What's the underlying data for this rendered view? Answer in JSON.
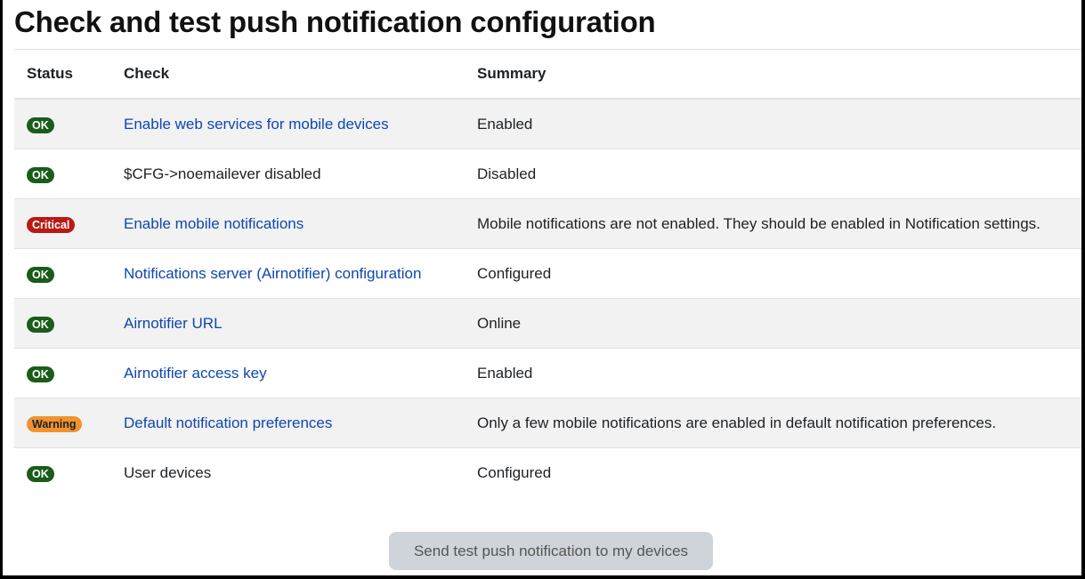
{
  "page": {
    "title": "Check and test push notification configuration"
  },
  "table": {
    "headers": {
      "status": "Status",
      "check": "Check",
      "summary": "Summary"
    },
    "rows": [
      {
        "status": "OK",
        "status_type": "ok",
        "check": "Enable web services for mobile devices",
        "check_is_link": true,
        "summary": "Enabled"
      },
      {
        "status": "OK",
        "status_type": "ok",
        "check": "$CFG->noemailever disabled",
        "check_is_link": false,
        "summary": "Disabled"
      },
      {
        "status": "Critical",
        "status_type": "critical",
        "check": "Enable mobile notifications",
        "check_is_link": true,
        "summary": "Mobile notifications are not enabled. They should be enabled in Notification settings."
      },
      {
        "status": "OK",
        "status_type": "ok",
        "check": "Notifications server (Airnotifier) configuration",
        "check_is_link": true,
        "summary": "Configured"
      },
      {
        "status": "OK",
        "status_type": "ok",
        "check": "Airnotifier URL",
        "check_is_link": true,
        "summary": "Online"
      },
      {
        "status": "OK",
        "status_type": "ok",
        "check": "Airnotifier access key",
        "check_is_link": true,
        "summary": "Enabled"
      },
      {
        "status": "Warning",
        "status_type": "warning",
        "check": "Default notification preferences",
        "check_is_link": true,
        "summary": "Only a few mobile notifications are enabled in default notification preferences."
      },
      {
        "status": "OK",
        "status_type": "ok",
        "check": "User devices",
        "check_is_link": false,
        "summary": "Configured"
      }
    ]
  },
  "actions": {
    "send_test_label": "Send test push notification to my devices",
    "send_test_disabled": true
  },
  "colors": {
    "ok": "#1a5c1a",
    "critical": "#b81b17",
    "warning": "#f0922e",
    "link": "#0f47ad"
  }
}
